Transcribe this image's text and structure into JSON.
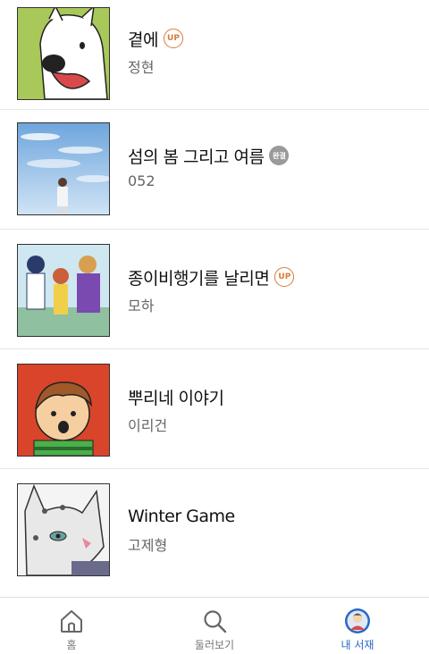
{
  "items": [
    {
      "title": "곁에",
      "author": "정현",
      "badge": "UP"
    },
    {
      "title": "섬의 봄 그리고 여름",
      "author": "052",
      "badge": "완결"
    },
    {
      "title": "종이비행기를 날리면",
      "author": "모하",
      "badge": "UP"
    },
    {
      "title": "뿌리네 이야기",
      "author": "이리건",
      "badge": ""
    },
    {
      "title": "Winter Game",
      "author": "고제형",
      "badge": ""
    }
  ],
  "tabbar": {
    "home_label": "홈",
    "browse_label": "둘러보기",
    "library_label": "내 서재"
  },
  "colors": {
    "up_badge": "#d97a3a",
    "done_badge": "#9a9a9a",
    "active_tab": "#2a67c9"
  }
}
